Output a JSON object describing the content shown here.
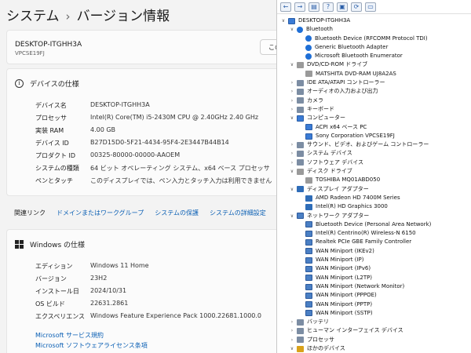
{
  "settings": {
    "breadcrumb_system": "システム",
    "breadcrumb_sep": "›",
    "breadcrumb_about": "バージョン情報",
    "device_name": "DESKTOP-ITGHH3A",
    "device_model": "VPCSE19FJ",
    "rename_label": "この",
    "device_spec_heading": "デバイスの仕様",
    "device_specs": [
      {
        "key": "デバイス名",
        "value": "DESKTOP-ITGHH3A"
      },
      {
        "key": "プロセッサ",
        "value": "Intel(R) Core(TM) i5-2430M CPU @ 2.40GHz   2.40 GHz"
      },
      {
        "key": "実装 RAM",
        "value": "4.00 GB"
      },
      {
        "key": "デバイス ID",
        "value": "B27D15D0-5F21-4434-95F4-2E3447B44B14"
      },
      {
        "key": "プロダクト ID",
        "value": "00325-80000-00000-AAOEM"
      },
      {
        "key": "システムの種類",
        "value": "64 ビット オペレーティング システム、x64 ベース プロセッサ"
      },
      {
        "key": "ペンとタッチ",
        "value": "このディスプレイでは、ペン入力とタッチ入力は利用できません"
      }
    ],
    "related_label": "関連リンク",
    "related_links": [
      "ドメインまたはワークグループ",
      "システムの保護",
      "システムの詳細設定"
    ],
    "windows_spec_heading": "Windows の仕様",
    "windows_specs": [
      {
        "key": "エディション",
        "value": "Windows 11 Home"
      },
      {
        "key": "バージョン",
        "value": "23H2"
      },
      {
        "key": "インストール日",
        "value": "2024/10/31"
      },
      {
        "key": "OS ビルド",
        "value": "22631.2861"
      },
      {
        "key": "エクスペリエンス",
        "value": "Windows Feature Experience Pack 1000.22681.1000.0"
      }
    ],
    "windows_links": [
      "Microsoft サービス規約",
      "Microsoft ソフトウェアライセンス条項"
    ]
  },
  "device_manager": {
    "toolbar_icons": [
      "back-icon",
      "forward-icon",
      "properties-icon",
      "help-icon",
      "update-driver-icon",
      "scan-icon",
      "monitor-icon"
    ],
    "tree": [
      {
        "level": 0,
        "toggle": "v",
        "icon": "pc",
        "label": "DESKTOP-ITGHH3A"
      },
      {
        "level": 1,
        "toggle": "v",
        "icon": "bt",
        "label": "Bluetooth"
      },
      {
        "level": 2,
        "toggle": "",
        "icon": "bt",
        "label": "Bluetooth Device (RFCOMM Protocol TDI)"
      },
      {
        "level": 2,
        "toggle": "",
        "icon": "bt",
        "label": "Generic Bluetooth Adapter"
      },
      {
        "level": 2,
        "toggle": "",
        "icon": "bt",
        "label": "Microsoft Bluetooth Enumerator"
      },
      {
        "level": 1,
        "toggle": "v",
        "icon": "disk",
        "label": "DVD/CD-ROM ドライブ"
      },
      {
        "level": 2,
        "toggle": "",
        "icon": "disk",
        "label": "MATSHITA DVD-RAM UJ8A2AS"
      },
      {
        "level": 1,
        "toggle": ">",
        "icon": "gen",
        "label": "IDE ATA/ATAPI コントローラー"
      },
      {
        "level": 1,
        "toggle": ">",
        "icon": "gen",
        "label": "オーディオの入力および出力"
      },
      {
        "level": 1,
        "toggle": ">",
        "icon": "gen",
        "label": "カメラ"
      },
      {
        "level": 1,
        "toggle": ">",
        "icon": "gen",
        "label": "キーボード"
      },
      {
        "level": 1,
        "toggle": "v",
        "icon": "pc",
        "label": "コンピューター"
      },
      {
        "level": 2,
        "toggle": "",
        "icon": "pc",
        "label": "ACPI x64 ベース PC"
      },
      {
        "level": 2,
        "toggle": "",
        "icon": "pc",
        "label": "Sony Corporation VPCSE19FJ"
      },
      {
        "level": 1,
        "toggle": ">",
        "icon": "gen",
        "label": "サウンド、ビデオ、およびゲーム コントローラー"
      },
      {
        "level": 1,
        "toggle": ">",
        "icon": "gen",
        "label": "システム デバイス"
      },
      {
        "level": 1,
        "toggle": ">",
        "icon": "gen",
        "label": "ソフトウェア デバイス"
      },
      {
        "level": 1,
        "toggle": "v",
        "icon": "disk",
        "label": "ディスク ドライブ"
      },
      {
        "level": 2,
        "toggle": "",
        "icon": "disk",
        "label": "TOSHIBA MQ01ABD050"
      },
      {
        "level": 1,
        "toggle": "v",
        "icon": "disp",
        "label": "ディスプレイ アダプター"
      },
      {
        "level": 2,
        "toggle": "",
        "icon": "disp",
        "label": "AMD Radeon HD 7400M Series"
      },
      {
        "level": 2,
        "toggle": "",
        "icon": "disp",
        "label": "Intel(R) HD Graphics 3000"
      },
      {
        "level": 1,
        "toggle": "v",
        "icon": "net",
        "label": "ネットワーク アダプター"
      },
      {
        "level": 2,
        "toggle": "",
        "icon": "net",
        "label": "Bluetooth Device (Personal Area Network)"
      },
      {
        "level": 2,
        "toggle": "",
        "icon": "net",
        "label": "Intel(R) Centrino(R) Wireless-N 6150"
      },
      {
        "level": 2,
        "toggle": "",
        "icon": "net",
        "label": "Realtek PCIe GBE Family Controller"
      },
      {
        "level": 2,
        "toggle": "",
        "icon": "net",
        "label": "WAN Miniport (IKEv2)"
      },
      {
        "level": 2,
        "toggle": "",
        "icon": "net",
        "label": "WAN Miniport (IP)"
      },
      {
        "level": 2,
        "toggle": "",
        "icon": "net",
        "label": "WAN Miniport (IPv6)"
      },
      {
        "level": 2,
        "toggle": "",
        "icon": "net",
        "label": "WAN Miniport (L2TP)"
      },
      {
        "level": 2,
        "toggle": "",
        "icon": "net",
        "label": "WAN Miniport (Network Monitor)"
      },
      {
        "level": 2,
        "toggle": "",
        "icon": "net",
        "label": "WAN Miniport (PPPOE)"
      },
      {
        "level": 2,
        "toggle": "",
        "icon": "net",
        "label": "WAN Miniport (PPTP)"
      },
      {
        "level": 2,
        "toggle": "",
        "icon": "net",
        "label": "WAN Miniport (SSTP)"
      },
      {
        "level": 1,
        "toggle": ">",
        "icon": "gen",
        "label": "バッテリ"
      },
      {
        "level": 1,
        "toggle": ">",
        "icon": "gen",
        "label": "ヒューマン インターフェイス デバイス"
      },
      {
        "level": 1,
        "toggle": ">",
        "icon": "gen",
        "label": "プロセッサ"
      },
      {
        "level": 1,
        "toggle": "v",
        "icon": "warn",
        "label": "ほかのデバイス"
      }
    ]
  }
}
